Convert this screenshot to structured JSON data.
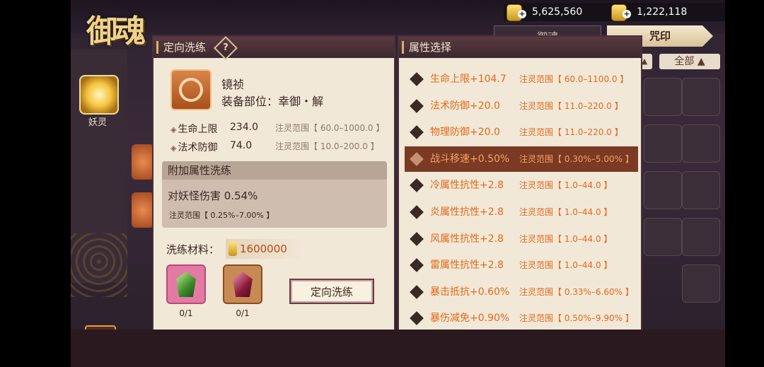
{
  "title": "御魂",
  "currency": [
    {
      "value": "5,625,560"
    },
    {
      "value": "1,222,118"
    }
  ],
  "tabs": [
    {
      "label": "御魂"
    },
    {
      "label": "咒印"
    }
  ],
  "filter": {
    "label": "全部"
  },
  "sidebar": {
    "label": "妖灵"
  },
  "left_panel": {
    "header": "定向洗练",
    "help": "?",
    "item": {
      "name": "镜祯",
      "slot": "装备部位：幸御・解"
    },
    "stats": [
      {
        "name": "生命上限",
        "value": "234.0",
        "range": "注灵范围【 60.0–1000.0 】"
      },
      {
        "name": "法术防御",
        "value": "74.0",
        "range": "注灵范围【 10.0–200.0 】"
      }
    ],
    "addon": {
      "title": "附加属性洗练",
      "stat": "对妖怪伤害   0.54%",
      "range": "注灵范围【 0.25%–7.00% 】"
    },
    "material": {
      "label": "洗练材料：",
      "cost": "1600000"
    },
    "gems": [
      {
        "count": "0/1"
      },
      {
        "count": "0/1"
      }
    ],
    "button": "定向洗练"
  },
  "right_panel": {
    "header": "属性选择",
    "attributes": [
      {
        "name": "生命上限+104.7",
        "range": "注灵范围【 60.0–1100.0 】"
      },
      {
        "name": "法术防御+20.0",
        "range": "注灵范围【 11.0–220.0 】"
      },
      {
        "name": "物理防御+20.0",
        "range": "注灵范围【 11.0–220.0 】"
      },
      {
        "name": "战斗移速+0.50%",
        "range": "注灵范围【 0.30%–5.00% 】"
      },
      {
        "name": "冷属性抗性+2.8",
        "range": "注灵范围【 1.0–44.0 】"
      },
      {
        "name": "炎属性抗性+2.8",
        "range": "注灵范围【 1.0–44.0 】"
      },
      {
        "name": "风属性抗性+2.8",
        "range": "注灵范围【 1.0–44.0 】"
      },
      {
        "name": "雷属性抗性+2.8",
        "range": "注灵范围【 1.0–44.0 】"
      },
      {
        "name": "暴击抵抗+0.60%",
        "range": "注灵范围【 0.33%–6.60% 】"
      },
      {
        "name": "暴伤减免+0.90%",
        "range": "注灵范围【 0.50%–9.90% 】"
      }
    ],
    "selected_index": 3
  },
  "colors": {
    "accent_orange": "#e06a1a",
    "selected_row": "#7a3a24",
    "panel_bg": "#f2e8d8"
  }
}
